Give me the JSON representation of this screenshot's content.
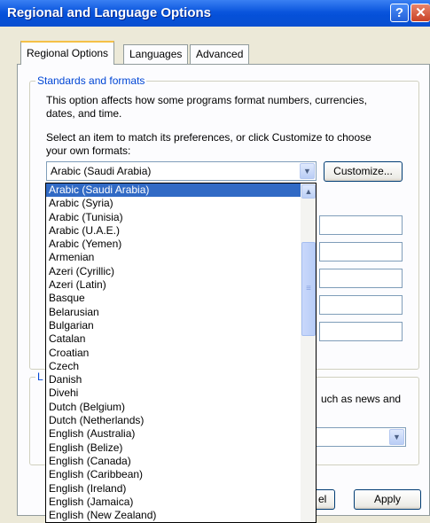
{
  "window": {
    "title": "Regional and Language Options",
    "help_glyph": "?",
    "close_glyph": "✕"
  },
  "tabs": [
    {
      "label": "Regional Options"
    },
    {
      "label": "Languages"
    },
    {
      "label": "Advanced"
    }
  ],
  "standards": {
    "group_label": "Standards and formats",
    "description_line1": "This option affects how some programs format numbers, currencies,",
    "description_line2": "dates, and time.",
    "instruction_line1": "Select an item to match its preferences, or click Customize to choose",
    "instruction_line2": "your own formats:",
    "selected_format": "Arabic (Saudi Arabia)",
    "customize_label": "Customize..."
  },
  "location": {
    "group_label_fragment": "L",
    "description_fragment": "uch as news and"
  },
  "dialog_buttons": {
    "cancel_fragment": "el",
    "apply_label": "Apply"
  },
  "format_list": {
    "items": [
      "Arabic (Saudi Arabia)",
      "Arabic (Syria)",
      "Arabic (Tunisia)",
      "Arabic (U.A.E.)",
      "Arabic (Yemen)",
      "Armenian",
      "Azeri (Cyrillic)",
      "Azeri (Latin)",
      "Basque",
      "Belarusian",
      "Bulgarian",
      "Catalan",
      "Croatian",
      "Czech",
      "Danish",
      "Divehi",
      "Dutch (Belgium)",
      "Dutch (Netherlands)",
      "English (Australia)",
      "English (Belize)",
      "English (Canada)",
      "English (Caribbean)",
      "English (Ireland)",
      "English (Jamaica)",
      "English (New Zealand)"
    ],
    "selected_index": 0
  },
  "colors": {
    "title_bar": "#0a55dd",
    "selection": "#316ac5",
    "group_label": "#0046d5",
    "dialog_bg": "#ece9d8"
  }
}
